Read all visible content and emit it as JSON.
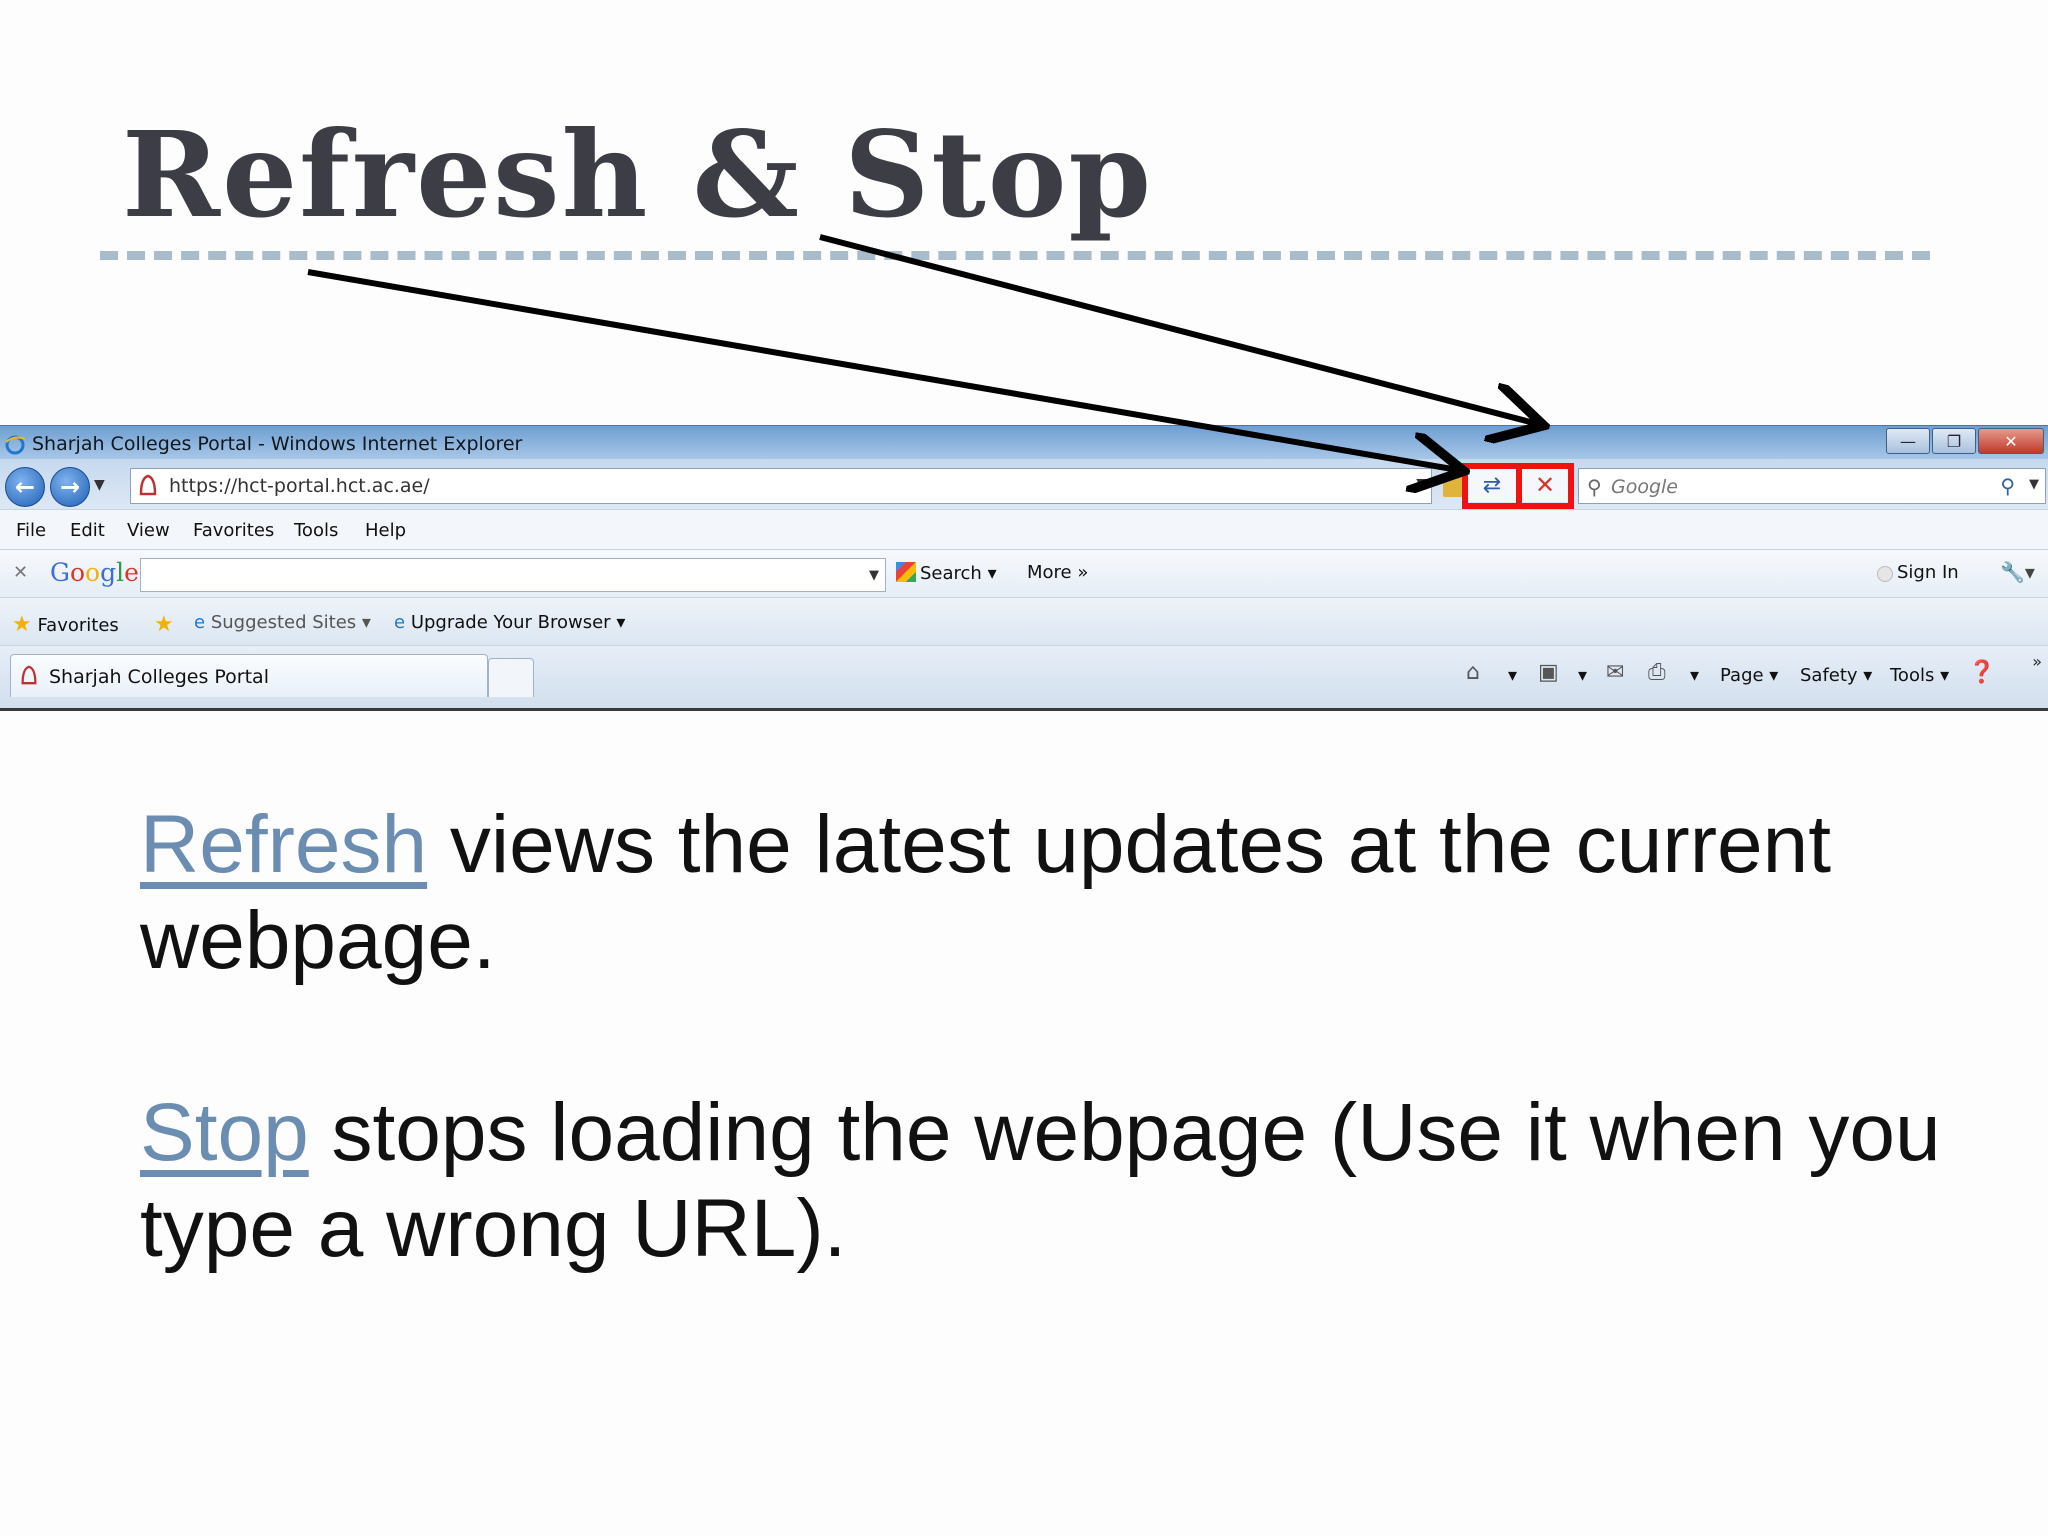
{
  "slide": {
    "title": "Refresh & Stop",
    "paragraphs": [
      {
        "keyword": "Refresh",
        "text": " views the latest updates at the current webpage."
      },
      {
        "keyword": "Stop",
        "text": " stops loading the webpage (Use it when you type a wrong URL)."
      }
    ]
  },
  "browser": {
    "window_title": "Sharjah Colleges Portal - Windows Internet Explorer",
    "address": {
      "url": "https://hct-portal.hct.ac.ae/"
    },
    "search": {
      "placeholder": "Google"
    },
    "menu": [
      "File",
      "Edit",
      "View",
      "Favorites",
      "Tools",
      "Help"
    ],
    "google_toolbar": {
      "logo": "Google",
      "search_label": "Search",
      "more_label": "More »",
      "sign_in_label": "Sign In"
    },
    "favorites_bar": {
      "favorites_label": "Favorites",
      "suggested_sites_label": "Suggested Sites",
      "upgrade_label": "Upgrade Your Browser"
    },
    "tab": {
      "label": "Sharjah Colleges Portal"
    },
    "command_bar": {
      "page": "Page",
      "safety": "Safety",
      "tools": "Tools"
    }
  },
  "colors": {
    "highlight": "#ee1212",
    "keyword": "#6b8db2",
    "title": "#3d3d45",
    "dash_rule": "#a9bccb"
  },
  "icons": [
    "ie-logo-icon",
    "back-arrow-icon",
    "forward-arrow-icon",
    "page-icon",
    "lock-icon",
    "refresh-icon",
    "stop-icon",
    "search-icon",
    "home-icon",
    "feeds-icon",
    "mail-icon",
    "print-icon",
    "help-icon",
    "star-icon"
  ]
}
